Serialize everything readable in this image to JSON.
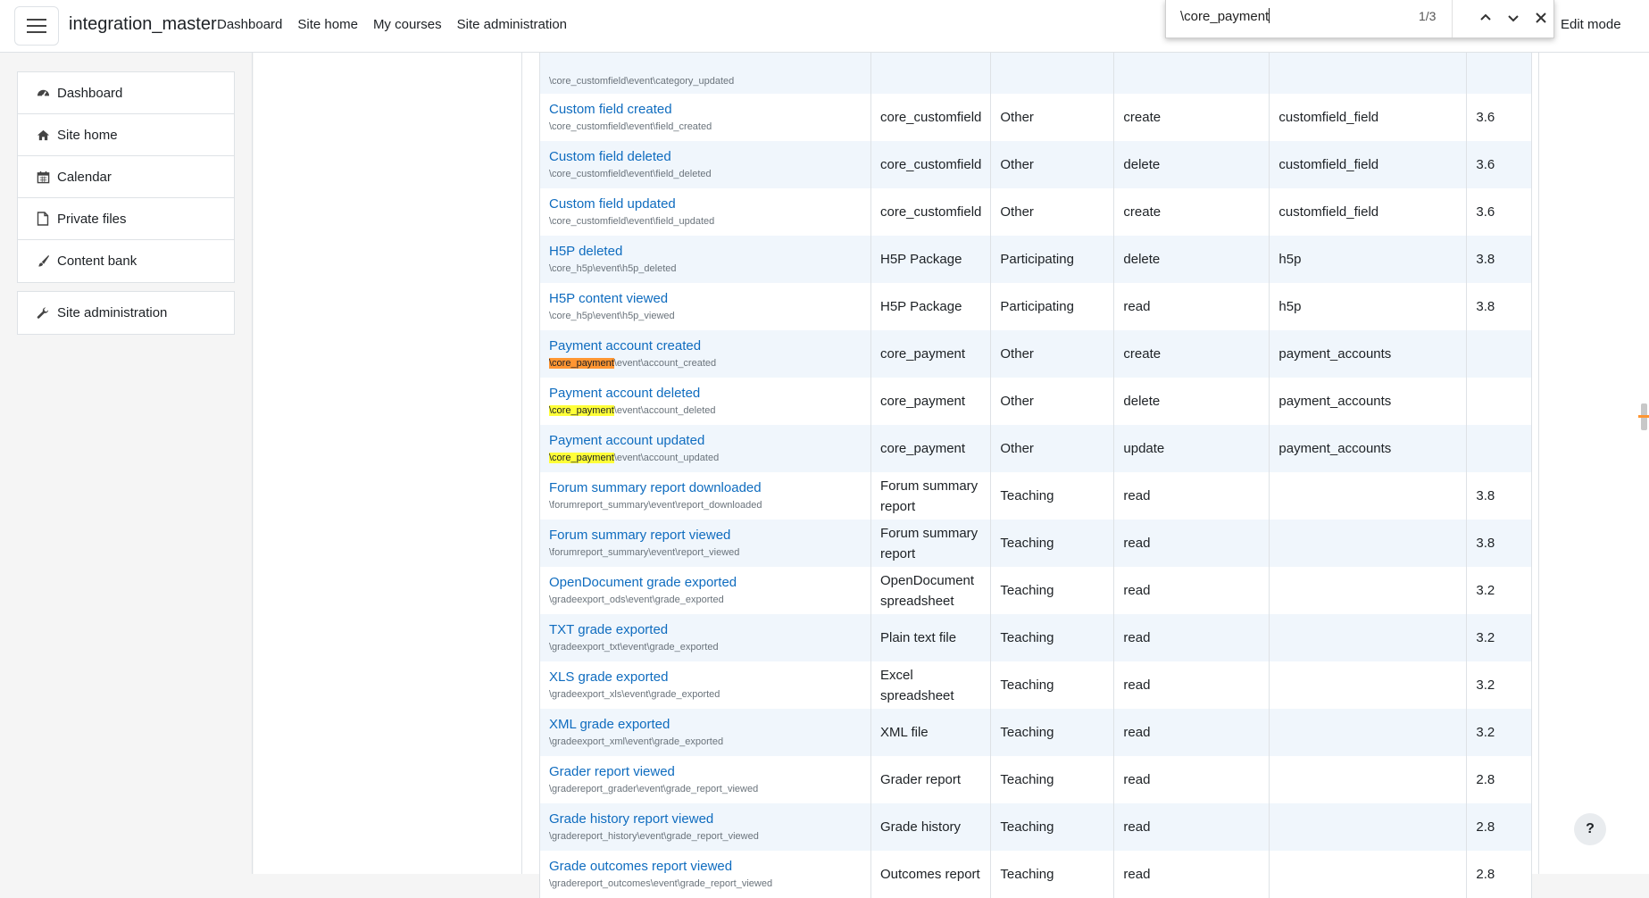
{
  "header": {
    "brand": "integration_master",
    "nav": [
      "Dashboard",
      "Site home",
      "My courses",
      "Site administration"
    ],
    "edit_mode": "Edit mode"
  },
  "findbar": {
    "query": "\\core_payment",
    "count": "1/3"
  },
  "drawer": {
    "items": [
      {
        "label": "Dashboard",
        "icon": "dashboard-icon"
      },
      {
        "label": "Site home",
        "icon": "home-icon"
      },
      {
        "label": "Calendar",
        "icon": "calendar-icon"
      },
      {
        "label": "Private files",
        "icon": "file-icon"
      },
      {
        "label": "Content bank",
        "icon": "brush-icon"
      }
    ],
    "admin": {
      "label": "Site administration",
      "icon": "wrench-icon"
    }
  },
  "table": {
    "rows": [
      {
        "name": "",
        "cls": "\\core_customfield\\event\\category_updated",
        "component": "",
        "edu": "",
        "crud": "",
        "affected": "",
        "since": ""
      },
      {
        "name": "Custom field created",
        "cls": "\\core_customfield\\event\\field_created",
        "component": "core_customfield",
        "edu": "Other",
        "crud": "create",
        "affected": "customfield_field",
        "since": "3.6"
      },
      {
        "name": "Custom field deleted",
        "cls": "\\core_customfield\\event\\field_deleted",
        "component": "core_customfield",
        "edu": "Other",
        "crud": "delete",
        "affected": "customfield_field",
        "since": "3.6"
      },
      {
        "name": "Custom field updated",
        "cls": "\\core_customfield\\event\\field_updated",
        "component": "core_customfield",
        "edu": "Other",
        "crud": "create",
        "affected": "customfield_field",
        "since": "3.6"
      },
      {
        "name": "H5P deleted",
        "cls": "\\core_h5p\\event\\h5p_deleted",
        "component": "H5P Package",
        "edu": "Participating",
        "crud": "delete",
        "affected": "h5p",
        "since": "3.8"
      },
      {
        "name": "H5P content viewed",
        "cls": "\\core_h5p\\event\\h5p_viewed",
        "component": "H5P Package",
        "edu": "Participating",
        "crud": "read",
        "affected": "h5p",
        "since": "3.8"
      },
      {
        "name": "Payment account created",
        "cls_hl": "\\core_payment",
        "cls_rest": "\\event\\account_created",
        "hl_active": true,
        "component": "core_payment",
        "edu": "Other",
        "crud": "create",
        "affected": "payment_accounts",
        "since": ""
      },
      {
        "name": "Payment account deleted",
        "cls_hl": "\\core_payment",
        "cls_rest": "\\event\\account_deleted",
        "hl_active": false,
        "component": "core_payment",
        "edu": "Other",
        "crud": "delete",
        "affected": "payment_accounts",
        "since": ""
      },
      {
        "name": "Payment account updated",
        "cls_hl": "\\core_payment",
        "cls_rest": "\\event\\account_updated",
        "hl_active": false,
        "component": "core_payment",
        "edu": "Other",
        "crud": "update",
        "affected": "payment_accounts",
        "since": ""
      },
      {
        "name": "Forum summary report downloaded",
        "cls": "\\forumreport_summary\\event\\report_downloaded",
        "component": "Forum summary report",
        "edu": "Teaching",
        "crud": "read",
        "affected": "",
        "since": "3.8"
      },
      {
        "name": "Forum summary report viewed",
        "cls": "\\forumreport_summary\\event\\report_viewed",
        "component": "Forum summary report",
        "edu": "Teaching",
        "crud": "read",
        "affected": "",
        "since": "3.8"
      },
      {
        "name": "OpenDocument grade exported",
        "cls": "\\gradeexport_ods\\event\\grade_exported",
        "component": "OpenDocument spreadsheet",
        "edu": "Teaching",
        "crud": "read",
        "affected": "",
        "since": "3.2"
      },
      {
        "name": "TXT grade exported",
        "cls": "\\gradeexport_txt\\event\\grade_exported",
        "component": "Plain text file",
        "edu": "Teaching",
        "crud": "read",
        "affected": "",
        "since": "3.2"
      },
      {
        "name": "XLS grade exported",
        "cls": "\\gradeexport_xls\\event\\grade_exported",
        "component": "Excel spreadsheet",
        "edu": "Teaching",
        "crud": "read",
        "affected": "",
        "since": "3.2"
      },
      {
        "name": "XML grade exported",
        "cls": "\\gradeexport_xml\\event\\grade_exported",
        "component": "XML file",
        "edu": "Teaching",
        "crud": "read",
        "affected": "",
        "since": "3.2"
      },
      {
        "name": "Grader report viewed",
        "cls": "\\gradereport_grader\\event\\grade_report_viewed",
        "component": "Grader report",
        "edu": "Teaching",
        "crud": "read",
        "affected": "",
        "since": "2.8"
      },
      {
        "name": "Grade history report viewed",
        "cls": "\\gradereport_history\\event\\grade_report_viewed",
        "component": "Grade history",
        "edu": "Teaching",
        "crud": "read",
        "affected": "",
        "since": "2.8"
      },
      {
        "name": "Grade outcomes report viewed",
        "cls": "\\gradereport_outcomes\\event\\grade_report_viewed",
        "component": "Outcomes report",
        "edu": "Teaching",
        "crud": "read",
        "affected": "",
        "since": "2.8"
      }
    ]
  },
  "help": "?",
  "colors": {
    "link": "#0f6cbf",
    "highlight": "#ffff38",
    "highlight_active": "#ff9632",
    "row_stripe": "#f0f6fc"
  }
}
